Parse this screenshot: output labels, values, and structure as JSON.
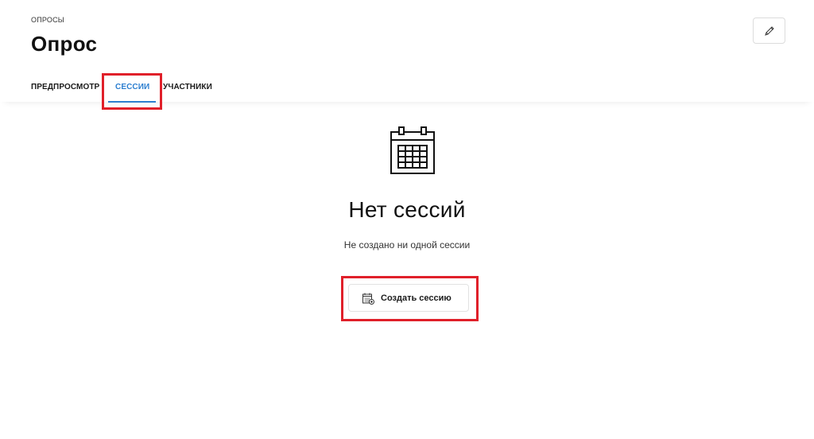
{
  "header": {
    "breadcrumb": "ОПРОСЫ",
    "title": "Опрос",
    "edit_icon": "pencil-icon"
  },
  "tabs": [
    {
      "label": "ПРЕДПРОСМОТР",
      "active": false
    },
    {
      "label": "СЕССИИ",
      "active": true
    },
    {
      "label": "УЧАСТНИКИ",
      "active": false
    }
  ],
  "empty_state": {
    "icon": "calendar-icon",
    "title": "Нет сессий",
    "subtitle": "Не создано ни одной сессии",
    "button_label": "Создать сессию",
    "button_icon": "calendar-add-icon"
  },
  "colors": {
    "accent": "#2d7fd0",
    "highlight": "#e0202a",
    "text": "#1a1a1a"
  }
}
